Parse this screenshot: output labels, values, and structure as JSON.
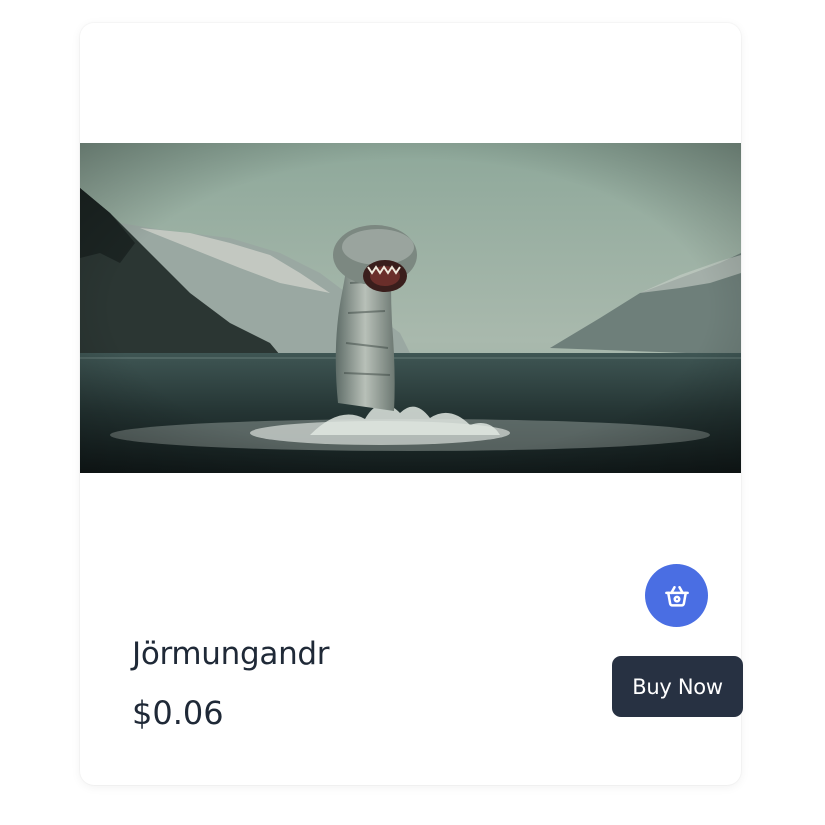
{
  "product": {
    "name": "Jörmungandr",
    "price": "$0.06",
    "image_icon": "sea-serpent-photo",
    "buy_label": "Buy Now",
    "cart_icon": "basket-icon"
  },
  "colors": {
    "accent": "#4a6ee3",
    "button_dark": "#273142",
    "text": "#1f2937"
  }
}
